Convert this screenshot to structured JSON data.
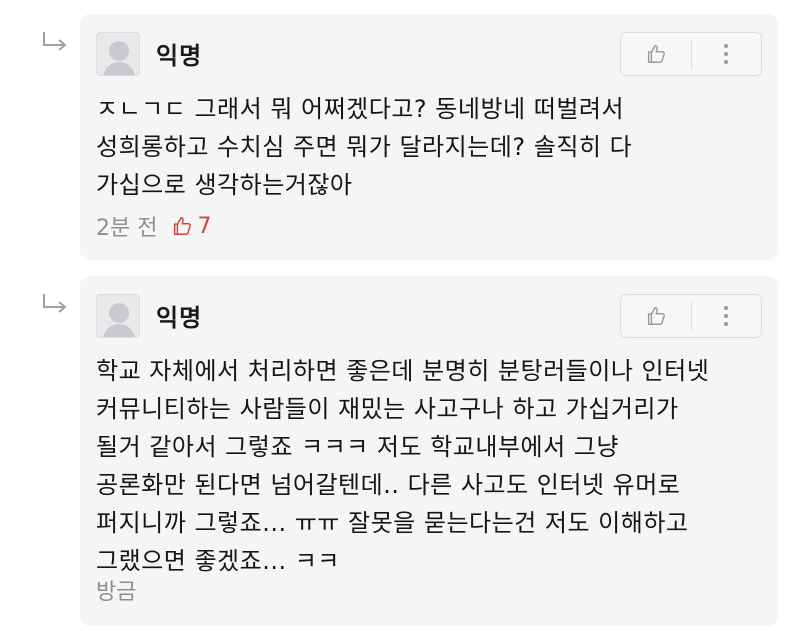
{
  "comments": [
    {
      "author": "익명",
      "text": "ㅈㄴㄱㄷ 그래서 뭐 어쩌겠다고? 동네방네 떠벌려서\n성희롱하고 수치심 주면 뭐가 달라지는데? 솔직히 다\n가십으로 생각하는거잖아",
      "time": "2분 전",
      "likes": "7"
    },
    {
      "author": "익명",
      "text": "학교 자체에서 처리하면 좋은데 분명히 분탕러들이나 인터넷\n커뮤니티하는 사람들이 재밌는 사고구나 하고 가십거리가\n될거 같아서 그렇죠 ㅋㅋㅋ 저도 학교내부에서 그냥\n공론화만 된다면 넘어갈텐데.. 다른 사고도 인터넷 유머로\n퍼지니까 그렇죠... ㅠㅠ 잘못을 묻는다는건 저도 이해하고\n그랬으면 좋겠죠... ㅋㅋ",
      "time": "방금"
    }
  ],
  "icons": {
    "reply": "reply-arrow-icon",
    "like": "thumbs-up-icon",
    "more": "more-vertical-icon"
  },
  "colors": {
    "card_bg": "#f5f5f7",
    "like_accent": "#d0463a",
    "meta_text": "#8e8e93"
  }
}
